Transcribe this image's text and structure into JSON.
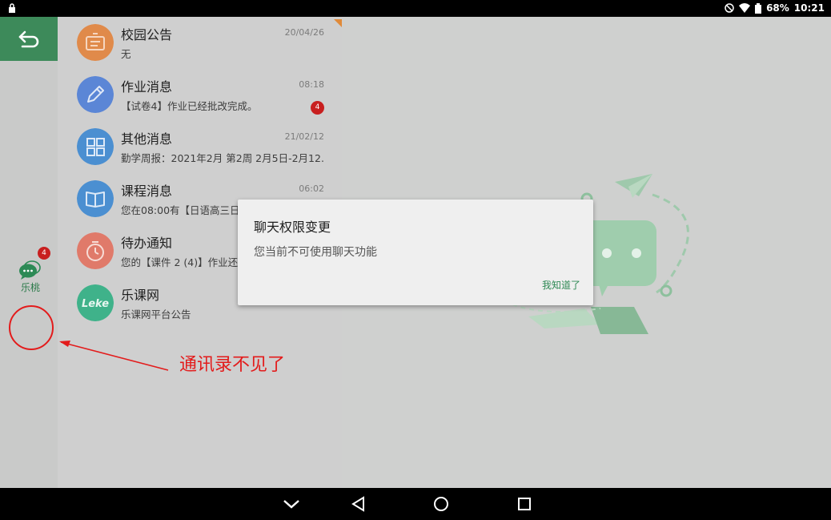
{
  "status_bar": {
    "battery": "68%",
    "time": "10:21"
  },
  "rail": {
    "back_icon": "back-arrow-icon",
    "chat_label": "乐桃",
    "chat_badge": "4"
  },
  "messages": [
    {
      "title": "校园公告",
      "subtitle": "无",
      "time": "20/04/26",
      "badge": "",
      "avatar_color": "#e08a4a",
      "icon": "bulletin-icon"
    },
    {
      "title": "作业消息",
      "subtitle": "【试卷4】作业已经批改完成。",
      "time": "08:18",
      "badge": "4",
      "avatar_color": "#5b86d6",
      "icon": "pencil-icon"
    },
    {
      "title": "其他消息",
      "subtitle": "勤学周报：2021年2月 第2周 2月5日-2月12...",
      "time": "21/02/12",
      "badge": "",
      "avatar_color": "#4b8fd1",
      "icon": "grid-icon"
    },
    {
      "title": "课程消息",
      "subtitle": "您在08:00有【日语高三日",
      "time": "06:02",
      "badge": "",
      "avatar_color": "#4b8fd1",
      "icon": "book-icon"
    },
    {
      "title": "待办通知",
      "subtitle": "您的【课件 2 (4)】作业还",
      "time": "",
      "badge": "",
      "avatar_color": "#e07a6a",
      "icon": "clock-icon"
    },
    {
      "title": "乐课网",
      "subtitle": "乐课网平台公告",
      "time": "",
      "badge": "",
      "avatar_color": "#3fb28a",
      "icon": "leke-logo-icon"
    }
  ],
  "dialog": {
    "title": "聊天权限变更",
    "message": "您当前不可使用聊天功能",
    "confirm": "我知道了"
  },
  "annotation": {
    "text": "通讯录不见了"
  },
  "colors": {
    "accent": "#3d8a5a",
    "annotation": "#e31b1b",
    "badge": "#c81f1f"
  }
}
